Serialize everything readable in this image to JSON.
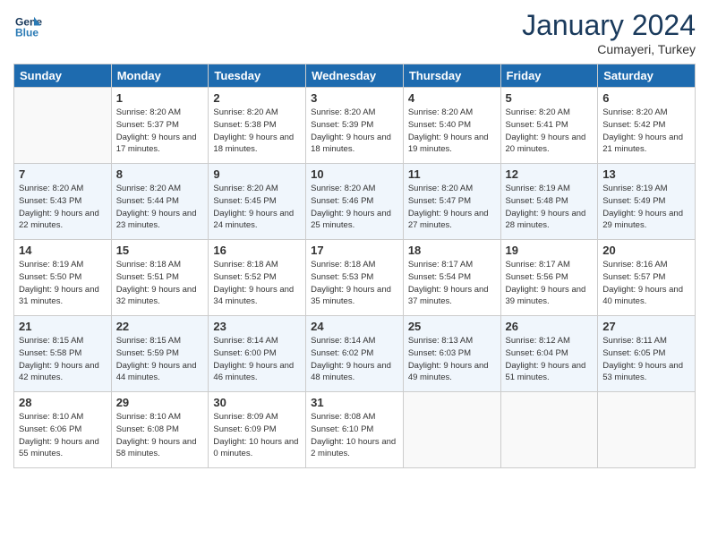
{
  "logo": {
    "line1": "General",
    "line2": "Blue"
  },
  "title": "January 2024",
  "subtitle": "Cumayeri, Turkey",
  "days_header": [
    "Sunday",
    "Monday",
    "Tuesday",
    "Wednesday",
    "Thursday",
    "Friday",
    "Saturday"
  ],
  "weeks": [
    [
      {
        "day": "",
        "sunrise": "",
        "sunset": "",
        "daylight": ""
      },
      {
        "day": "1",
        "sunrise": "Sunrise: 8:20 AM",
        "sunset": "Sunset: 5:37 PM",
        "daylight": "Daylight: 9 hours and 17 minutes."
      },
      {
        "day": "2",
        "sunrise": "Sunrise: 8:20 AM",
        "sunset": "Sunset: 5:38 PM",
        "daylight": "Daylight: 9 hours and 18 minutes."
      },
      {
        "day": "3",
        "sunrise": "Sunrise: 8:20 AM",
        "sunset": "Sunset: 5:39 PM",
        "daylight": "Daylight: 9 hours and 18 minutes."
      },
      {
        "day": "4",
        "sunrise": "Sunrise: 8:20 AM",
        "sunset": "Sunset: 5:40 PM",
        "daylight": "Daylight: 9 hours and 19 minutes."
      },
      {
        "day": "5",
        "sunrise": "Sunrise: 8:20 AM",
        "sunset": "Sunset: 5:41 PM",
        "daylight": "Daylight: 9 hours and 20 minutes."
      },
      {
        "day": "6",
        "sunrise": "Sunrise: 8:20 AM",
        "sunset": "Sunset: 5:42 PM",
        "daylight": "Daylight: 9 hours and 21 minutes."
      }
    ],
    [
      {
        "day": "7",
        "sunrise": "Sunrise: 8:20 AM",
        "sunset": "Sunset: 5:43 PM",
        "daylight": "Daylight: 9 hours and 22 minutes."
      },
      {
        "day": "8",
        "sunrise": "Sunrise: 8:20 AM",
        "sunset": "Sunset: 5:44 PM",
        "daylight": "Daylight: 9 hours and 23 minutes."
      },
      {
        "day": "9",
        "sunrise": "Sunrise: 8:20 AM",
        "sunset": "Sunset: 5:45 PM",
        "daylight": "Daylight: 9 hours and 24 minutes."
      },
      {
        "day": "10",
        "sunrise": "Sunrise: 8:20 AM",
        "sunset": "Sunset: 5:46 PM",
        "daylight": "Daylight: 9 hours and 25 minutes."
      },
      {
        "day": "11",
        "sunrise": "Sunrise: 8:20 AM",
        "sunset": "Sunset: 5:47 PM",
        "daylight": "Daylight: 9 hours and 27 minutes."
      },
      {
        "day": "12",
        "sunrise": "Sunrise: 8:19 AM",
        "sunset": "Sunset: 5:48 PM",
        "daylight": "Daylight: 9 hours and 28 minutes."
      },
      {
        "day": "13",
        "sunrise": "Sunrise: 8:19 AM",
        "sunset": "Sunset: 5:49 PM",
        "daylight": "Daylight: 9 hours and 29 minutes."
      }
    ],
    [
      {
        "day": "14",
        "sunrise": "Sunrise: 8:19 AM",
        "sunset": "Sunset: 5:50 PM",
        "daylight": "Daylight: 9 hours and 31 minutes."
      },
      {
        "day": "15",
        "sunrise": "Sunrise: 8:18 AM",
        "sunset": "Sunset: 5:51 PM",
        "daylight": "Daylight: 9 hours and 32 minutes."
      },
      {
        "day": "16",
        "sunrise": "Sunrise: 8:18 AM",
        "sunset": "Sunset: 5:52 PM",
        "daylight": "Daylight: 9 hours and 34 minutes."
      },
      {
        "day": "17",
        "sunrise": "Sunrise: 8:18 AM",
        "sunset": "Sunset: 5:53 PM",
        "daylight": "Daylight: 9 hours and 35 minutes."
      },
      {
        "day": "18",
        "sunrise": "Sunrise: 8:17 AM",
        "sunset": "Sunset: 5:54 PM",
        "daylight": "Daylight: 9 hours and 37 minutes."
      },
      {
        "day": "19",
        "sunrise": "Sunrise: 8:17 AM",
        "sunset": "Sunset: 5:56 PM",
        "daylight": "Daylight: 9 hours and 39 minutes."
      },
      {
        "day": "20",
        "sunrise": "Sunrise: 8:16 AM",
        "sunset": "Sunset: 5:57 PM",
        "daylight": "Daylight: 9 hours and 40 minutes."
      }
    ],
    [
      {
        "day": "21",
        "sunrise": "Sunrise: 8:15 AM",
        "sunset": "Sunset: 5:58 PM",
        "daylight": "Daylight: 9 hours and 42 minutes."
      },
      {
        "day": "22",
        "sunrise": "Sunrise: 8:15 AM",
        "sunset": "Sunset: 5:59 PM",
        "daylight": "Daylight: 9 hours and 44 minutes."
      },
      {
        "day": "23",
        "sunrise": "Sunrise: 8:14 AM",
        "sunset": "Sunset: 6:00 PM",
        "daylight": "Daylight: 9 hours and 46 minutes."
      },
      {
        "day": "24",
        "sunrise": "Sunrise: 8:14 AM",
        "sunset": "Sunset: 6:02 PM",
        "daylight": "Daylight: 9 hours and 48 minutes."
      },
      {
        "day": "25",
        "sunrise": "Sunrise: 8:13 AM",
        "sunset": "Sunset: 6:03 PM",
        "daylight": "Daylight: 9 hours and 49 minutes."
      },
      {
        "day": "26",
        "sunrise": "Sunrise: 8:12 AM",
        "sunset": "Sunset: 6:04 PM",
        "daylight": "Daylight: 9 hours and 51 minutes."
      },
      {
        "day": "27",
        "sunrise": "Sunrise: 8:11 AM",
        "sunset": "Sunset: 6:05 PM",
        "daylight": "Daylight: 9 hours and 53 minutes."
      }
    ],
    [
      {
        "day": "28",
        "sunrise": "Sunrise: 8:10 AM",
        "sunset": "Sunset: 6:06 PM",
        "daylight": "Daylight: 9 hours and 55 minutes."
      },
      {
        "day": "29",
        "sunrise": "Sunrise: 8:10 AM",
        "sunset": "Sunset: 6:08 PM",
        "daylight": "Daylight: 9 hours and 58 minutes."
      },
      {
        "day": "30",
        "sunrise": "Sunrise: 8:09 AM",
        "sunset": "Sunset: 6:09 PM",
        "daylight": "Daylight: 10 hours and 0 minutes."
      },
      {
        "day": "31",
        "sunrise": "Sunrise: 8:08 AM",
        "sunset": "Sunset: 6:10 PM",
        "daylight": "Daylight: 10 hours and 2 minutes."
      },
      {
        "day": "",
        "sunrise": "",
        "sunset": "",
        "daylight": ""
      },
      {
        "day": "",
        "sunrise": "",
        "sunset": "",
        "daylight": ""
      },
      {
        "day": "",
        "sunrise": "",
        "sunset": "",
        "daylight": ""
      }
    ]
  ]
}
